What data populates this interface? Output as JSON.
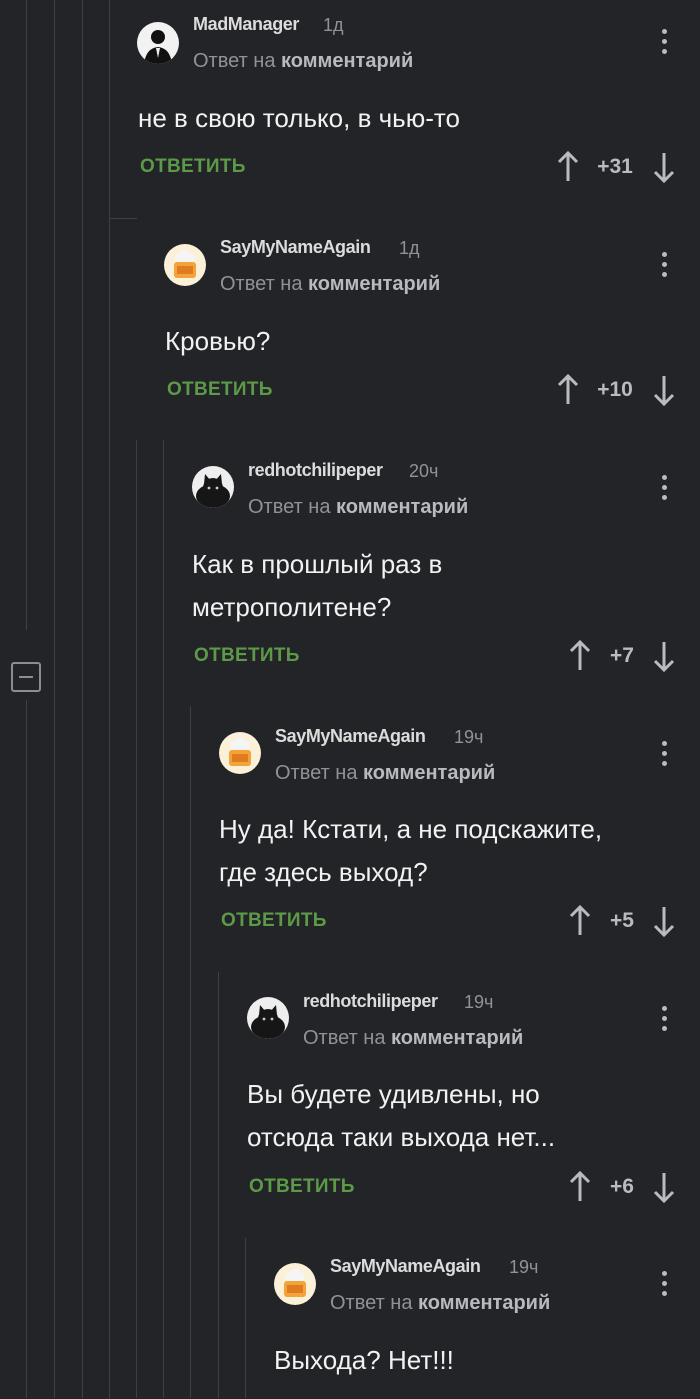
{
  "reply_button_label": "ОТВЕТИТЬ",
  "reply_to_prefix": "Ответ на",
  "reply_to_link": "комментарий",
  "colors": {
    "background": "#222427",
    "reply_green": "#5d9a48",
    "thread_line": "#3d4044"
  },
  "comments": [
    {
      "author": "MadManager",
      "time": "1д",
      "avatar": "man-in-suit-avatar",
      "text_lines": [
        "не в свою только, в чью-то"
      ],
      "score": "+31"
    },
    {
      "author": "SayMyNameAgain",
      "time": "1д",
      "avatar": "chef-avatar",
      "text_lines": [
        "Кровью?"
      ],
      "score": "+10"
    },
    {
      "author": "redhotchilipeper",
      "time": "20ч",
      "avatar": "black-cat-avatar",
      "text_lines": [
        "Как в прошлый раз в",
        "метрополитене?"
      ],
      "score": "+7"
    },
    {
      "author": "SayMyNameAgain",
      "time": "19ч",
      "avatar": "chef-avatar",
      "text_lines": [
        "Ну да! Кстати, а не подскажите,",
        "где здесь выход?"
      ],
      "score": "+5"
    },
    {
      "author": "redhotchilipeper",
      "time": "19ч",
      "avatar": "black-cat-avatar",
      "text_lines": [
        "Вы будете удивлены, но",
        "отсюда таки выхода нет..."
      ],
      "score": "+6"
    },
    {
      "author": "SayMyNameAgain",
      "time": "19ч",
      "avatar": "chef-avatar",
      "text_lines": [
        "Выхода? Нет!!!"
      ],
      "score": ""
    }
  ]
}
